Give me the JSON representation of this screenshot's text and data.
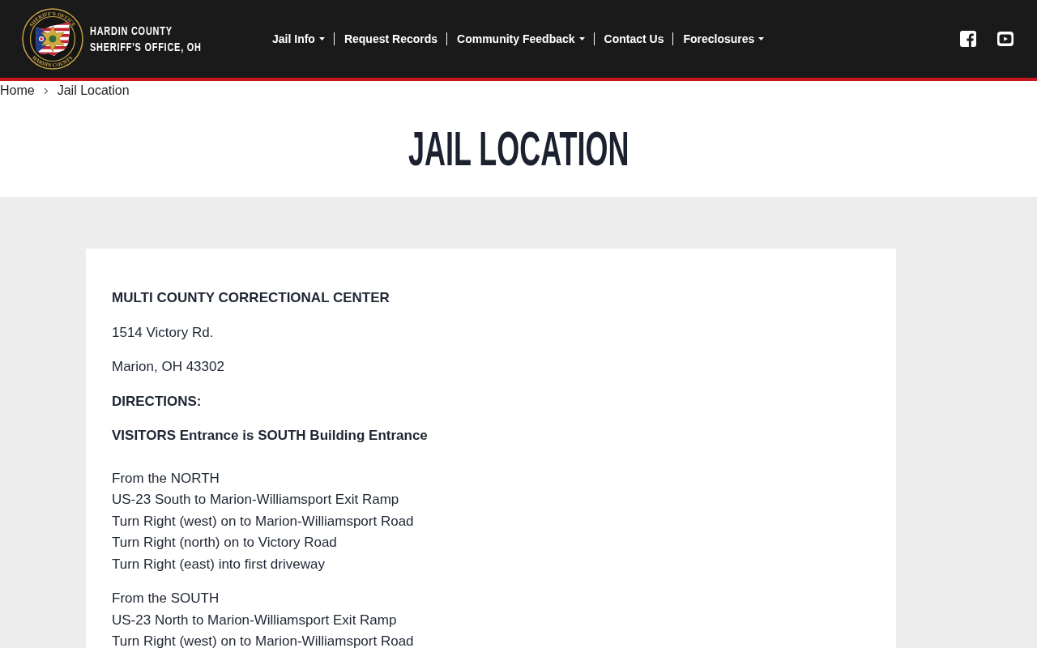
{
  "header": {
    "seal": {
      "top_text": "SHERIFF'S OFFICE",
      "bottom_text": "HARDIN COUNTY"
    },
    "site_name": [
      "HARDIN COUNTY",
      "SHERIFF'S OFFICE, OH"
    ],
    "nav": [
      {
        "label": "Jail Info",
        "dropdown": true
      },
      {
        "label": "Request Records",
        "dropdown": false
      },
      {
        "label": "Community Feedback",
        "dropdown": true
      },
      {
        "label": "Contact Us",
        "dropdown": false
      },
      {
        "label": "Foreclosures",
        "dropdown": true
      }
    ]
  },
  "breadcrumb": [
    "Home",
    "Jail Location"
  ],
  "page_title": "JAIL LOCATION",
  "content": [
    {
      "kind": "heading",
      "text": "MULTI COUNTY CORRECTIONAL CENTER"
    },
    {
      "kind": "paragraph",
      "text": "1514 Victory Rd."
    },
    {
      "kind": "paragraph",
      "text": "Marion, OH 43302"
    },
    {
      "kind": "heading",
      "text": "DIRECTIONS:"
    },
    {
      "kind": "heading",
      "text": "VISITORS Entrance is SOUTH Building Entrance"
    },
    {
      "kind": "route",
      "lines": [
        "From the NORTH",
        "US-23 South to Marion-Williamsport Exit Ramp",
        "Turn Right (west) on to Marion-Williamsport Road",
        "Turn Right (north) on to Victory Road",
        "Turn Right (east) into first driveway"
      ]
    },
    {
      "kind": "route",
      "lines": [
        "From the SOUTH",
        "US-23 North to Marion-Williamsport Exit Ramp",
        "Turn Right (west) on to Marion-Williamsport Road"
      ]
    }
  ]
}
